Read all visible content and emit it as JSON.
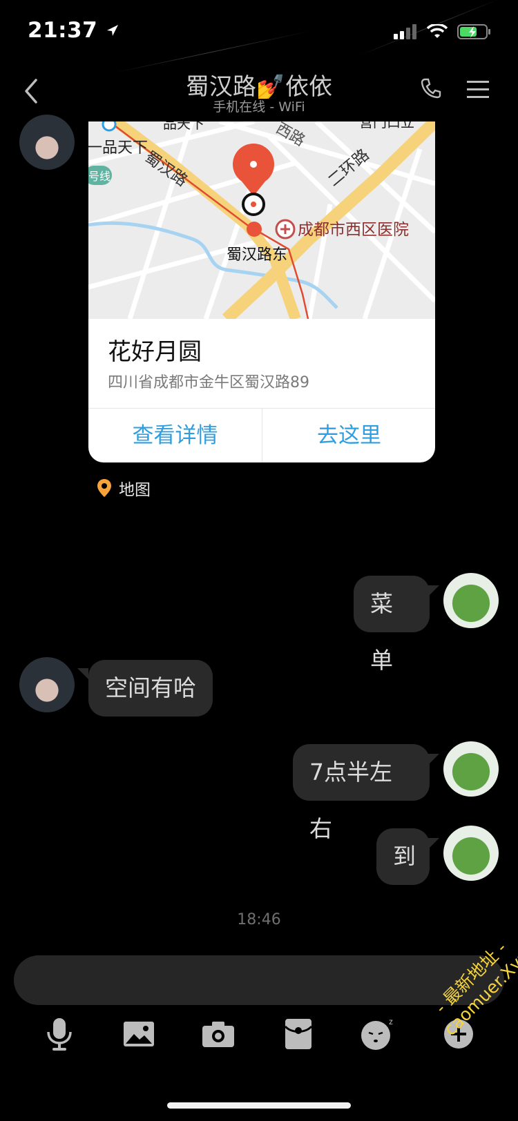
{
  "status_bar": {
    "time": "21:37"
  },
  "header": {
    "title": "蜀汉路💅依依",
    "subtitle": "手机在线 - WiFi",
    "icons": [
      "back-icon",
      "phone-icon",
      "menu-icon"
    ]
  },
  "location_card": {
    "map_labels": {
      "road_shuhan": "蜀汉路",
      "road_ring": "二环路",
      "road_xi": "西路",
      "poi_pinxia": "一品天下",
      "poi_hospital": "成都市西区医院",
      "metro_station": "蜀汉路东",
      "line_tag": "号线",
      "top_left_label": "品天下",
      "top_right_label": "营门口立"
    },
    "place_name": "花好月圆",
    "address": "四川省成都市金牛区蜀汉路89",
    "buttons": {
      "details": "查看详情",
      "navigate": "去这里"
    },
    "source_label": "地图"
  },
  "messages": [
    {
      "side": "right",
      "text": "菜单"
    },
    {
      "side": "left",
      "text": "空间有哈"
    },
    {
      "side": "right",
      "text": "7点半左右"
    },
    {
      "side": "right",
      "text": "到"
    }
  ],
  "timestamp": "18:46",
  "input": {
    "placeholder": ""
  },
  "toolbar": [
    "microphone-icon",
    "image-icon",
    "camera-icon",
    "red-packet-icon",
    "emoji-icon",
    "plus-icon"
  ],
  "watermark": {
    "line1": "- 最新地址 -",
    "line2": "caomuer.Xyz"
  },
  "colors": {
    "accent_blue": "#2d9fe0",
    "pin_red": "#e8533a",
    "bubble_bg": "#2a2a2a",
    "road_yellow": "#f6d27a"
  }
}
